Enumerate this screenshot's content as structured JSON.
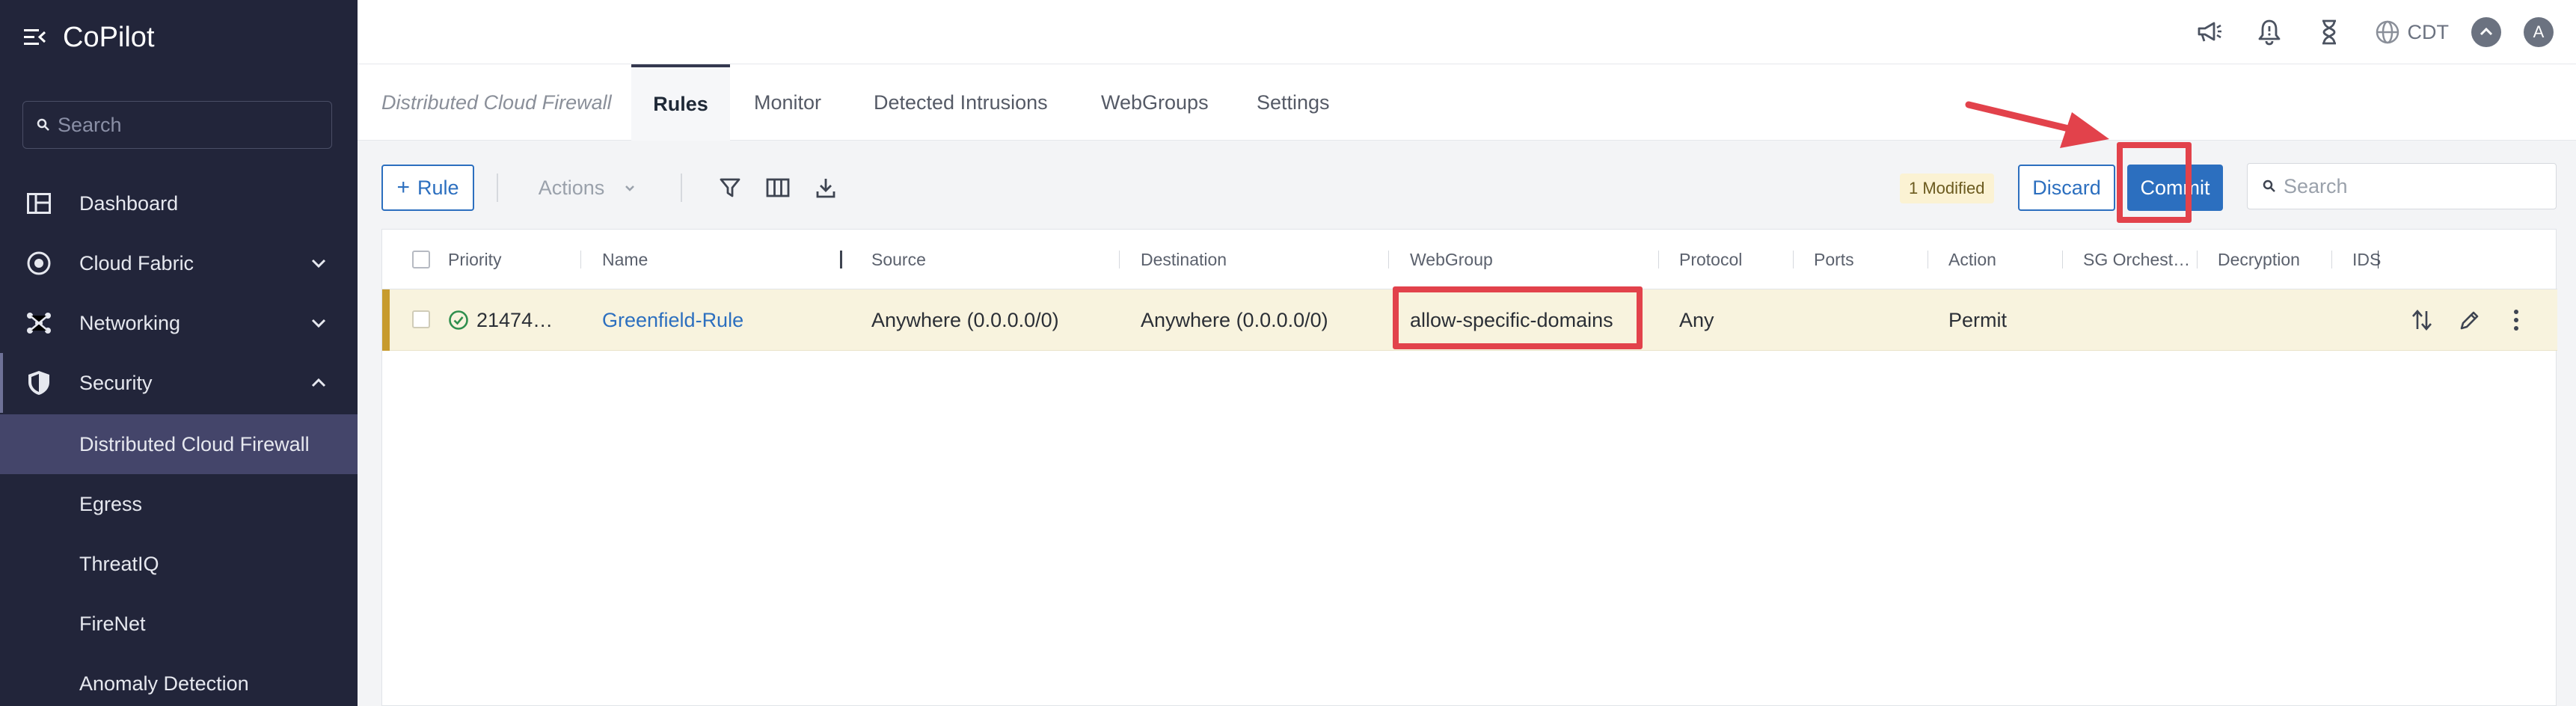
{
  "app": {
    "title": "CoPilot"
  },
  "sidebar": {
    "search_placeholder": "Search",
    "items": [
      {
        "label": "Dashboard"
      },
      {
        "label": "Cloud Fabric"
      },
      {
        "label": "Networking"
      },
      {
        "label": "Security"
      }
    ],
    "security_children": [
      {
        "label": "Distributed Cloud Firewall",
        "active": true
      },
      {
        "label": "Egress"
      },
      {
        "label": "ThreatIQ"
      },
      {
        "label": "FireNet"
      },
      {
        "label": "Anomaly Detection"
      }
    ]
  },
  "topbar": {
    "timezone": "CDT",
    "avatar_initial": "A"
  },
  "tabs": {
    "breadcrumb": "Distributed Cloud Firewall",
    "items": [
      {
        "label": "Rules",
        "active": true
      },
      {
        "label": "Monitor"
      },
      {
        "label": "Detected Intrusions"
      },
      {
        "label": "WebGroups"
      },
      {
        "label": "Settings"
      }
    ]
  },
  "toolbar": {
    "rule_label": "Rule",
    "actions_label": "Actions",
    "modified_badge": "1 Modified",
    "discard_label": "Discard",
    "commit_label": "Commit",
    "search_placeholder": "Search"
  },
  "table": {
    "columns": [
      "Priority",
      "Name",
      "Source",
      "Destination",
      "WebGroup",
      "Protocol",
      "Ports",
      "Action",
      "SG Orchest…",
      "Decryption",
      "IDS"
    ],
    "rows": [
      {
        "priority": "21474…",
        "name": "Greenfield-Rule",
        "source": "Anywhere (0.0.0.0/0)",
        "destination": "Anywhere (0.0.0.0/0)",
        "webgroup": "allow-specific-domains",
        "protocol": "Any",
        "ports": "",
        "action": "Permit",
        "sg_orchestration": "",
        "decryption": "",
        "ids": ""
      }
    ]
  },
  "colors": {
    "sidebar_bg": "#22253a",
    "accent": "#2c6fbf",
    "highlight": "#e2424b",
    "modified_row": "#f8f3de"
  }
}
